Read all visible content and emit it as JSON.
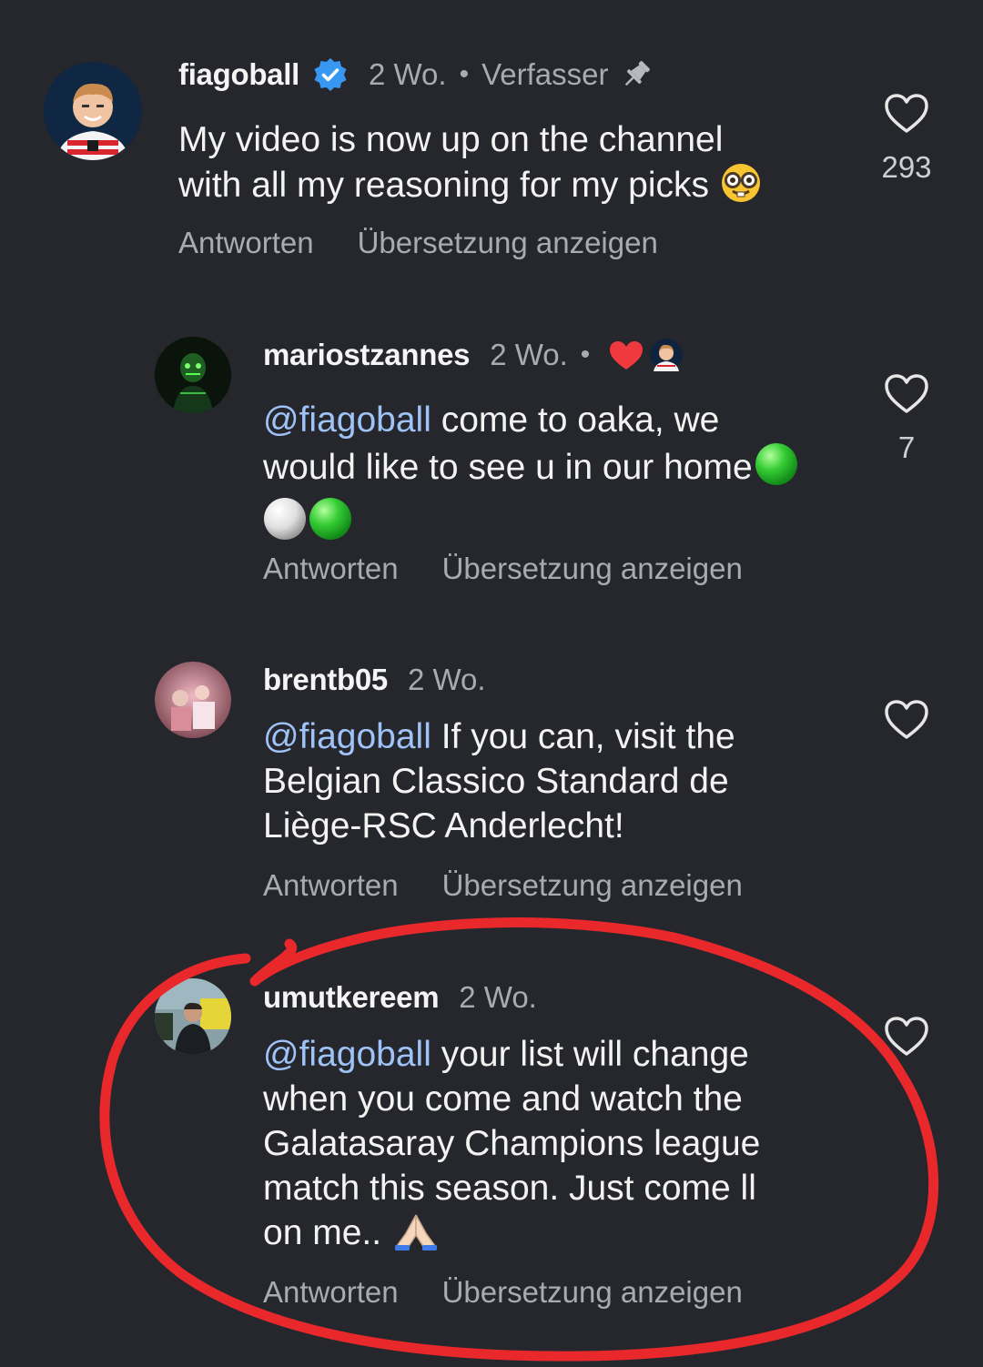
{
  "comments": [
    {
      "username": "fiagoball",
      "time": "2 Wo.",
      "dot": "•",
      "author_label": "Verfasser",
      "text": "My video is now up on the channel\nwith all my reasoning for my picks",
      "reply_label": "Antworten",
      "translate_label": "Übersetzung anzeigen",
      "like_count": "293",
      "icons": [
        "verified-badge-icon",
        "pin-icon",
        "nerd-face-emoji",
        "heart-outline-icon"
      ]
    },
    {
      "username": "mariostzannes",
      "time": "2 Wo.",
      "dot": "•",
      "mention": "@fiagoball",
      "text": " come to oaka, we\nwould like to see u in our home",
      "reply_label": "Antworten",
      "translate_label": "Übersetzung anzeigen",
      "like_count": "7",
      "icons": [
        "creator-heart-icon",
        "green-circle-emoji",
        "white-circle-emoji",
        "heart-outline-icon"
      ]
    },
    {
      "username": "brentb05",
      "time": "2 Wo.",
      "mention": "@fiagoball",
      "text": " If you can, visit the\nBelgian Classico Standard de\nLiège-RSC Anderlecht!",
      "reply_label": "Antworten",
      "translate_label": "Übersetzung anzeigen",
      "icons": [
        "heart-outline-icon"
      ]
    },
    {
      "username": "umutkereem",
      "time": "2 Wo.",
      "mention": "@fiagoball",
      "text": " your list will change\nwhen you come and watch the\nGalatasaray Champions league\nmatch this season. Just come ll\non me.. ",
      "reply_label": "Antworten",
      "translate_label": "Übersetzung anzeigen",
      "icons": [
        "folded-hands-emoji",
        "heart-outline-icon"
      ]
    }
  ],
  "colors": {
    "background": "#25272d",
    "mention": "#9fc3f7",
    "verified": "#3897f0",
    "annotation_circle": "#e8282b"
  }
}
